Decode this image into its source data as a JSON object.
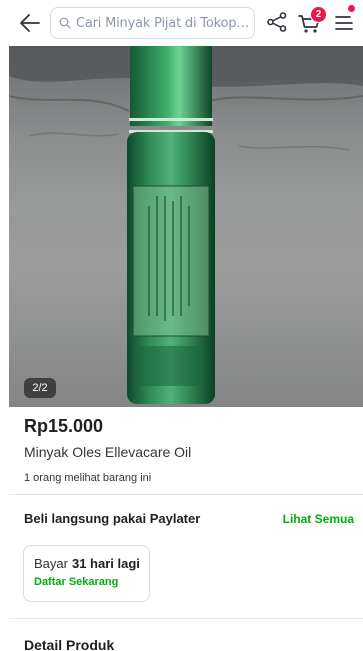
{
  "header": {
    "search_placeholder": "Cari Minyak Pijat di Tokope...",
    "cart_count": "2",
    "icons": [
      "back-arrow-icon",
      "search-icon",
      "share-icon",
      "cart-icon",
      "menu-icon"
    ]
  },
  "gallery": {
    "counter": "2/2"
  },
  "product": {
    "price": "Rp15.000",
    "name": "Minyak Oles Ellevacare Oil",
    "viewers": "1 orang melihat barang ini"
  },
  "paylater": {
    "title": "Beli langsung pakai Paylater",
    "see_all": "Lihat Semua",
    "card_prefix": "Bayar",
    "card_days": "31 hari lagi",
    "card_cta": "Daftar Sekarang"
  },
  "detail": {
    "title": "Detail Produk"
  },
  "colors": {
    "accent_green": "#03ac0e",
    "badge_red": "#ef144a"
  }
}
